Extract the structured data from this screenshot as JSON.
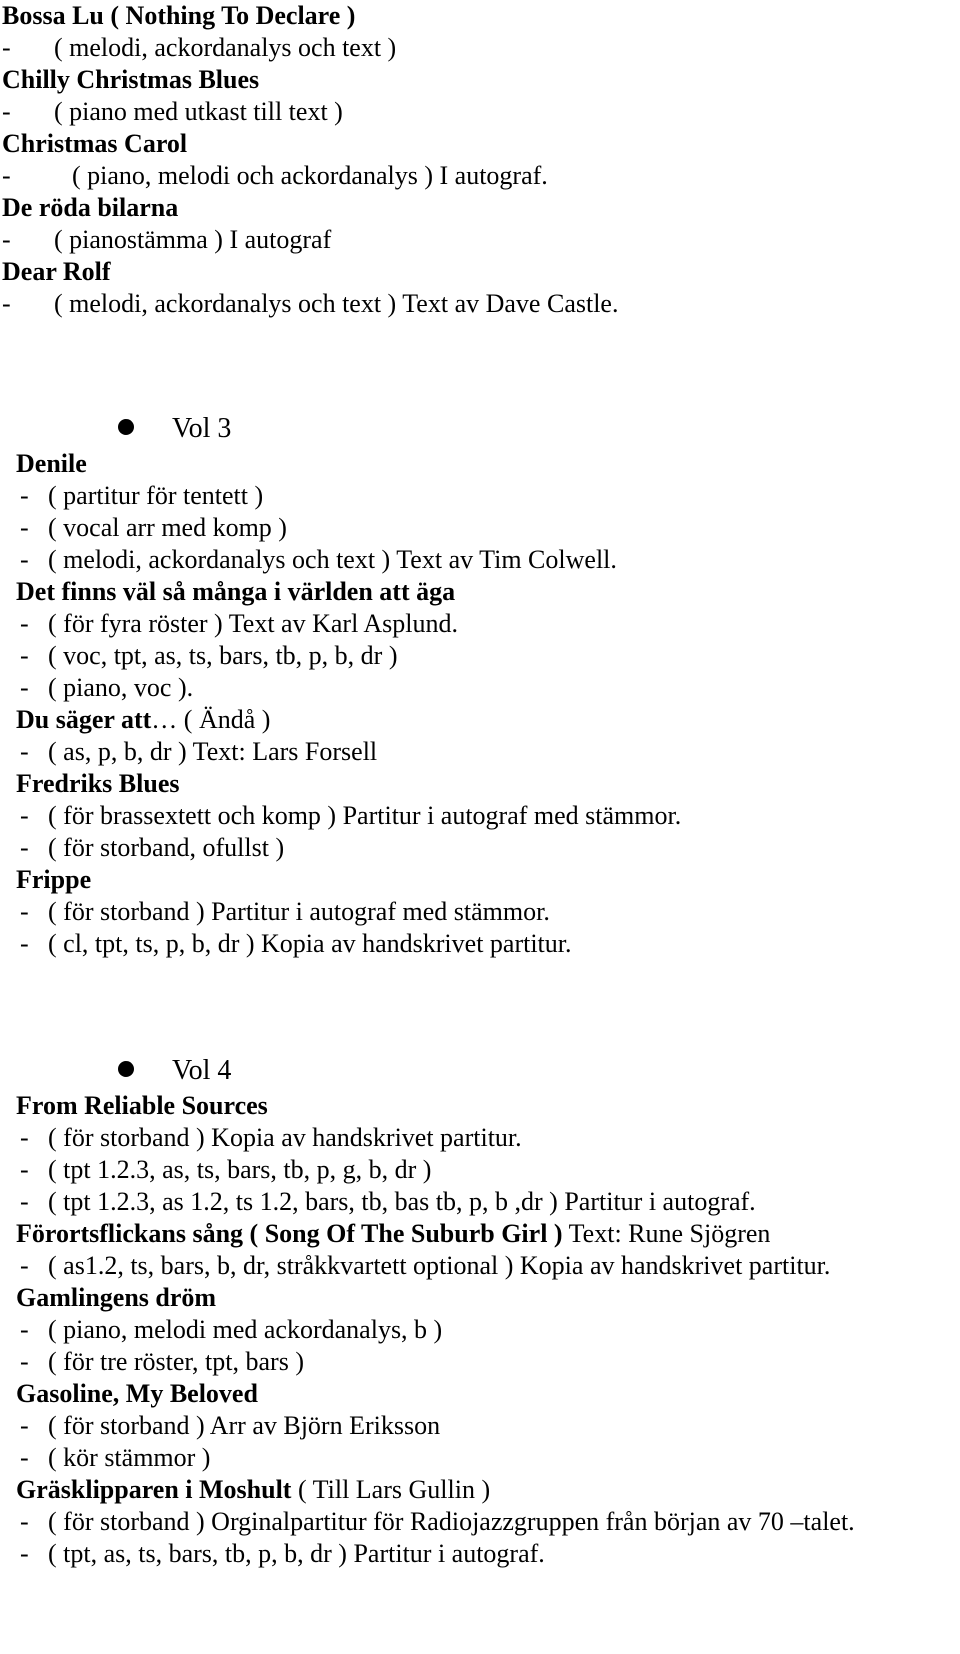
{
  "document": {
    "kind": "music-catalogue-page",
    "bullet_glyph": "•"
  },
  "sections": [
    {
      "id": "section-vol2-tail",
      "heading": null,
      "entries": [
        {
          "title": "Bossa Lu ( Nothing To Declare )",
          "title_suffix": "",
          "details": [
            {
              "dash": "-",
              "text": "( melodi, ackordanalys och text )",
              "deep": false
            }
          ]
        },
        {
          "title": "Chilly Christmas Blues",
          "title_suffix": "",
          "details": [
            {
              "dash": "-",
              "text": "( piano med utkast till text )",
              "deep": false
            }
          ]
        },
        {
          "title": "Christmas Carol",
          "title_suffix": "",
          "details": [
            {
              "dash": "-",
              "text": "( piano, melodi och ackordanalys ) I autograf.",
              "deep": true
            }
          ]
        },
        {
          "title": "De röda bilarna",
          "title_suffix": "",
          "details": [
            {
              "dash": "-",
              "text": "( pianostämma ) I autograf",
              "deep": false
            }
          ]
        },
        {
          "title": "Dear Rolf",
          "title_suffix": "",
          "details": [
            {
              "dash": "-",
              "text": "( melodi, ackordanalys och text ) Text av Dave Castle.",
              "deep": false
            }
          ]
        }
      ]
    },
    {
      "id": "section-vol3",
      "heading": "Vol 3",
      "entries": [
        {
          "title": "Denile",
          "title_suffix": "",
          "details": [
            {
              "dash": "-",
              "text": "( partitur för tentett )",
              "deep": false
            },
            {
              "dash": "-",
              "text": "( vocal arr med komp )",
              "deep": false
            },
            {
              "dash": "-",
              "text": "( melodi, ackordanalys och text ) Text av Tim Colwell.",
              "deep": false
            }
          ]
        },
        {
          "title": "Det finns väl så många i världen att äga",
          "title_suffix": "",
          "details": [
            {
              "dash": "-",
              "text": "( för fyra röster ) Text av Karl Asplund.",
              "deep": false
            },
            {
              "dash": "-",
              "text": "( voc, tpt, as, ts, bars, tb, p, b, dr )",
              "deep": false
            },
            {
              "dash": "-",
              "text": "( piano, voc ).",
              "deep": false
            }
          ]
        },
        {
          "title": "Du säger att",
          "title_suffix": "… ( Ändå )",
          "details": [
            {
              "dash": "-",
              "text": "( as, p, b, dr ) Text: Lars Forsell",
              "deep": false
            }
          ]
        },
        {
          "title": "Fredriks Blues",
          "title_suffix": "",
          "details": [
            {
              "dash": "-",
              "text": "( för brassextett och komp ) Partitur i autograf med stämmor.",
              "deep": false
            },
            {
              "dash": "-",
              "text": "( för storband, ofullst )",
              "deep": false
            }
          ]
        },
        {
          "title": "Frippe",
          "title_suffix": "",
          "details": [
            {
              "dash": "-",
              "text": "( för storband ) Partitur i autograf med stämmor.",
              "deep": false
            },
            {
              "dash": "-",
              "text": "( cl, tpt, ts, p, b, dr ) Kopia av handskrivet partitur.",
              "deep": false
            }
          ]
        }
      ]
    },
    {
      "id": "section-vol4",
      "heading": "Vol 4",
      "entries": [
        {
          "title": "From Reliable Sources",
          "title_suffix": "",
          "details": [
            {
              "dash": "-",
              "text": "( för storband ) Kopia av handskrivet partitur.",
              "deep": false
            },
            {
              "dash": "-",
              "text": "( tpt 1.2.3, as, ts, bars, tb, p, g, b, dr )",
              "deep": false
            },
            {
              "dash": "-",
              "text": "( tpt 1.2.3, as 1.2, ts 1.2, bars, tb, bas tb, p, b ,dr ) Partitur i autograf.",
              "deep": false
            }
          ]
        },
        {
          "title": "Förortsflickans sång ( Song Of The Suburb Girl )",
          "title_suffix": " Text: Rune Sjögren",
          "details": [
            {
              "dash": "-",
              "text": "( as1.2, ts, bars, b, dr, stråkkvartett optional ) Kopia av handskrivet partitur.",
              "deep": false
            }
          ]
        },
        {
          "title": "Gamlingens dröm",
          "title_suffix": "",
          "details": [
            {
              "dash": "-",
              "text": "( piano, melodi med ackordanalys, b )",
              "deep": false
            },
            {
              "dash": "-",
              "text": "( för tre röster, tpt, bars )",
              "deep": false
            }
          ]
        },
        {
          "title": "Gasoline, My Beloved",
          "title_suffix": "",
          "details": [
            {
              "dash": "-",
              "text": "( för storband ) Arr av Björn Eriksson",
              "deep": false
            },
            {
              "dash": "-",
              "text": "( kör stämmor )",
              "deep": false
            }
          ]
        },
        {
          "title": "Gräsklipparen i Moshult",
          "title_suffix": " ( Till Lars Gullin )",
          "details": [
            {
              "dash": "-",
              "text": "( för storband ) Orginalpartitur för Radiojazzgruppen från början av 70 –talet.",
              "deep": false
            },
            {
              "dash": "-",
              "text": "( tpt, as, ts, bars, tb, p, b, dr ) Partitur i autograf.",
              "deep": false
            }
          ]
        }
      ]
    }
  ]
}
